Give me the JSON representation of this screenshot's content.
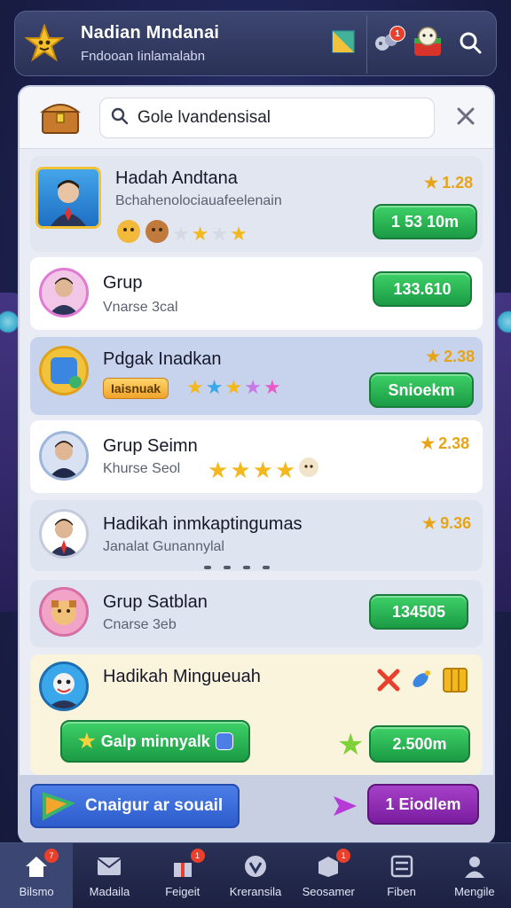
{
  "header": {
    "title": "Nadian Mndanai",
    "subtitle": "Fndooan Iinlamalabn",
    "notification_count": "1"
  },
  "search": {
    "value": "Gole lvandensisal",
    "placeholder": "Gole lvandensisal"
  },
  "rows": [
    {
      "name": "Hadah Andtana",
      "sub": "Bchahenolociauafeelenain",
      "score": "1.28",
      "button": "1 53 10m",
      "stars_filled": 3,
      "stars_total": 5
    },
    {
      "name": "Grup",
      "sub": "Vnarse 3cal",
      "button": "133.610"
    },
    {
      "name": "Pdgak Inadkan",
      "tag": "Iaisnuak",
      "score": "2.38",
      "button": "Snioekm"
    },
    {
      "name": "Grup Seimn",
      "sub": "Khurse Seol",
      "score": "2.38",
      "stars_filled": 4,
      "stars_total": 4
    },
    {
      "name": "Hadikah inmkaptingumas",
      "sub": "Janalat Gunannylal",
      "score": "9.36"
    },
    {
      "name": "Grup Satblan",
      "sub": "Cnarse 3eb",
      "button": "134505"
    },
    {
      "name": "Hadikah Mingueuah",
      "cta_left": "Galp minnyalk",
      "cta_right": "2.500m"
    }
  ],
  "bottom": {
    "cta_left": "Cnaigur ar souail",
    "cta_right": "1 Eiodlem"
  },
  "tabs": [
    {
      "label": "Bilsmo",
      "badge": "7"
    },
    {
      "label": "Madaila"
    },
    {
      "label": "Feigeit",
      "badge": "1"
    },
    {
      "label": "Kreransila"
    },
    {
      "label": "Seosamer",
      "badge": "1"
    },
    {
      "label": "Fiben"
    },
    {
      "label": "Mengile"
    }
  ],
  "colors": {
    "accent_green": "#2fbf5a",
    "accent_blue": "#3a6ad8",
    "accent_purple": "#8d2cb3",
    "star_gold": "#f2b81e",
    "badge_red": "#e8402c"
  },
  "icons": {
    "logo": "star-character-icon",
    "flag": "flag-icon",
    "notification": "gamepad-icon",
    "profile": "character-avatar-icon",
    "search": "search-icon",
    "close": "close-icon",
    "chest": "treasure-chest-icon"
  }
}
